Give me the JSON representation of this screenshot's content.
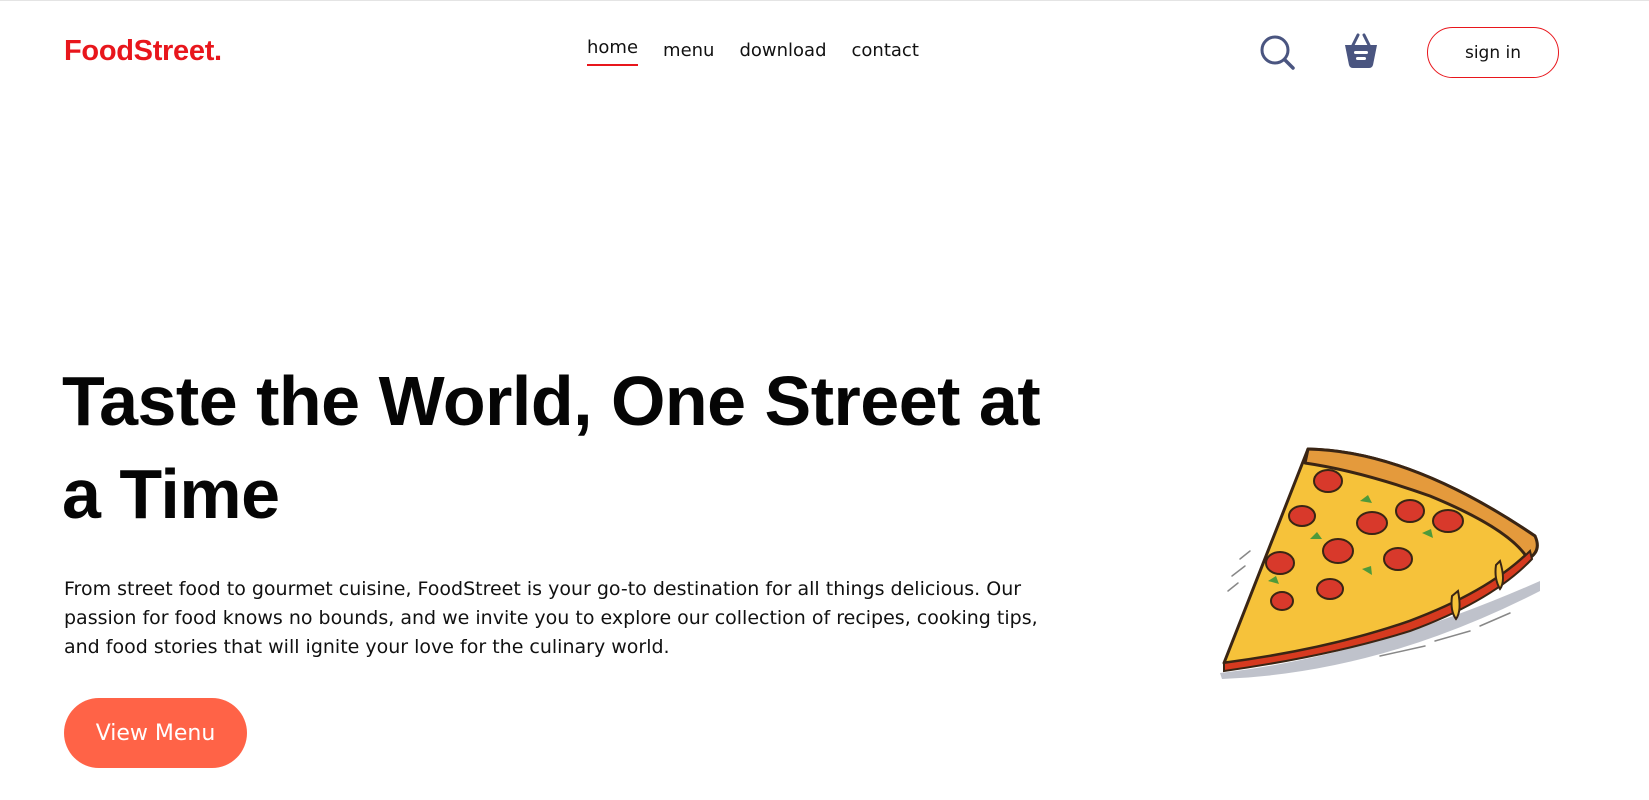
{
  "header": {
    "logo": "FoodStreet.",
    "nav": [
      {
        "label": "home",
        "active": true
      },
      {
        "label": "menu",
        "active": false
      },
      {
        "label": "download",
        "active": false
      },
      {
        "label": "contact",
        "active": false
      }
    ],
    "search_icon": "search-icon",
    "cart_icon": "shopping-basket-icon",
    "signin_label": "sign in"
  },
  "hero": {
    "title": "Taste the World, One Street at a Time",
    "description": "From street food to gourmet cuisine, FoodStreet is your go-to destination for all things delicious. Our passion for food knows no bounds, and we invite you to explore our collection of recipes, cooking tips, and food stories that will ignite your love for the culinary world.",
    "cta_label": "View Menu",
    "image": "pizza-slice-illustration"
  },
  "colors": {
    "brand_red": "#e8161c",
    "cta_coral": "#ff6347",
    "icon_slate": "#4a5580"
  }
}
